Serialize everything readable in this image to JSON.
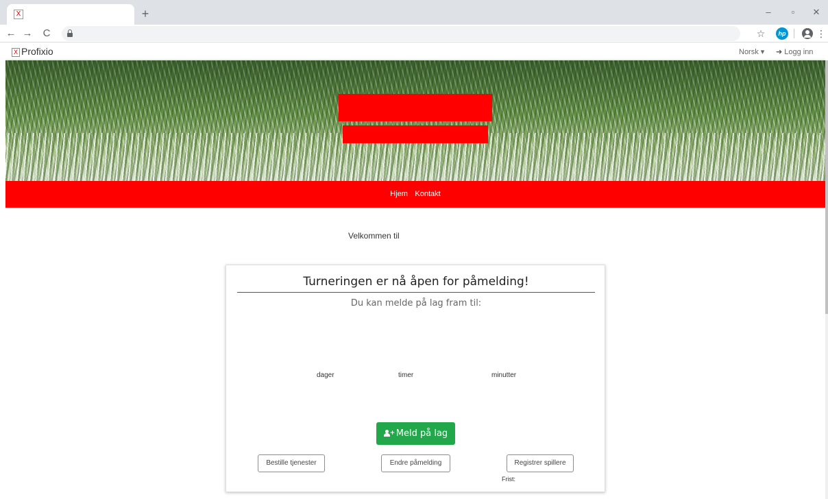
{
  "browser": {
    "tab_favicon": "X",
    "new_tab": "+",
    "window_controls": {
      "minimize": "–",
      "restore": "▫",
      "close": "✕"
    },
    "nav": {
      "back": "←",
      "forward": "→",
      "reload": "C"
    },
    "icons": {
      "star": "star-icon",
      "hp": "hp-icon",
      "profile": "profile-icon",
      "menu": "menu-icon"
    },
    "hp_label": "hp",
    "menu_glyph": "⋮",
    "star_glyph": "☆"
  },
  "site": {
    "logo_box": "X",
    "logo_text": "Profixio",
    "language": "Norsk ▾",
    "login_label": "Logg inn",
    "login_glyph": "➜"
  },
  "nav": {
    "items": [
      {
        "label": "Hjem"
      },
      {
        "label": "Kontakt"
      }
    ]
  },
  "welcome": {
    "text": "Velkommen til"
  },
  "card": {
    "title": "Turneringen er nå åpen for påmelding!",
    "subtitle": "Du kan melde på lag fram til:",
    "countdown": {
      "days_label": "dager",
      "hours_label": "timer",
      "minutes_label": "minutter"
    },
    "primary_button": "Meld på lag",
    "buttons": {
      "order_services": "Bestille tjenester",
      "change_registration": "Endre påmelding",
      "register_players": "Registrer spillere"
    },
    "deadline_label": "Frist:"
  },
  "colors": {
    "brand_red": "#ff0000",
    "primary_green": "#22a74a",
    "hp_blue": "#0096d6"
  }
}
